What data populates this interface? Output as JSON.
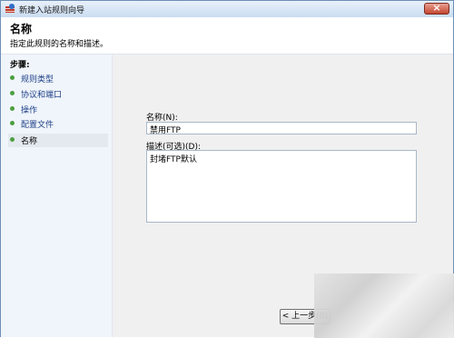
{
  "window": {
    "title": "新建入站规则向导"
  },
  "header": {
    "title": "名称",
    "description": "指定此规则的名称和描述。"
  },
  "steps": {
    "title": "步骤:",
    "items": [
      {
        "label": "规则类型"
      },
      {
        "label": "协议和端口"
      },
      {
        "label": "操作"
      },
      {
        "label": "配置文件"
      },
      {
        "label": "名称"
      }
    ]
  },
  "form": {
    "name_label": "名称(N):",
    "name_value": "禁用FTP",
    "desc_label": "描述(可选)(D):",
    "desc_value": "封堵FTP默认"
  },
  "buttons": {
    "back": "< 上一步(B)"
  },
  "colors": {
    "bullet": "#4d9e3f",
    "link": "#1e3f87",
    "close": "#c3462f"
  }
}
